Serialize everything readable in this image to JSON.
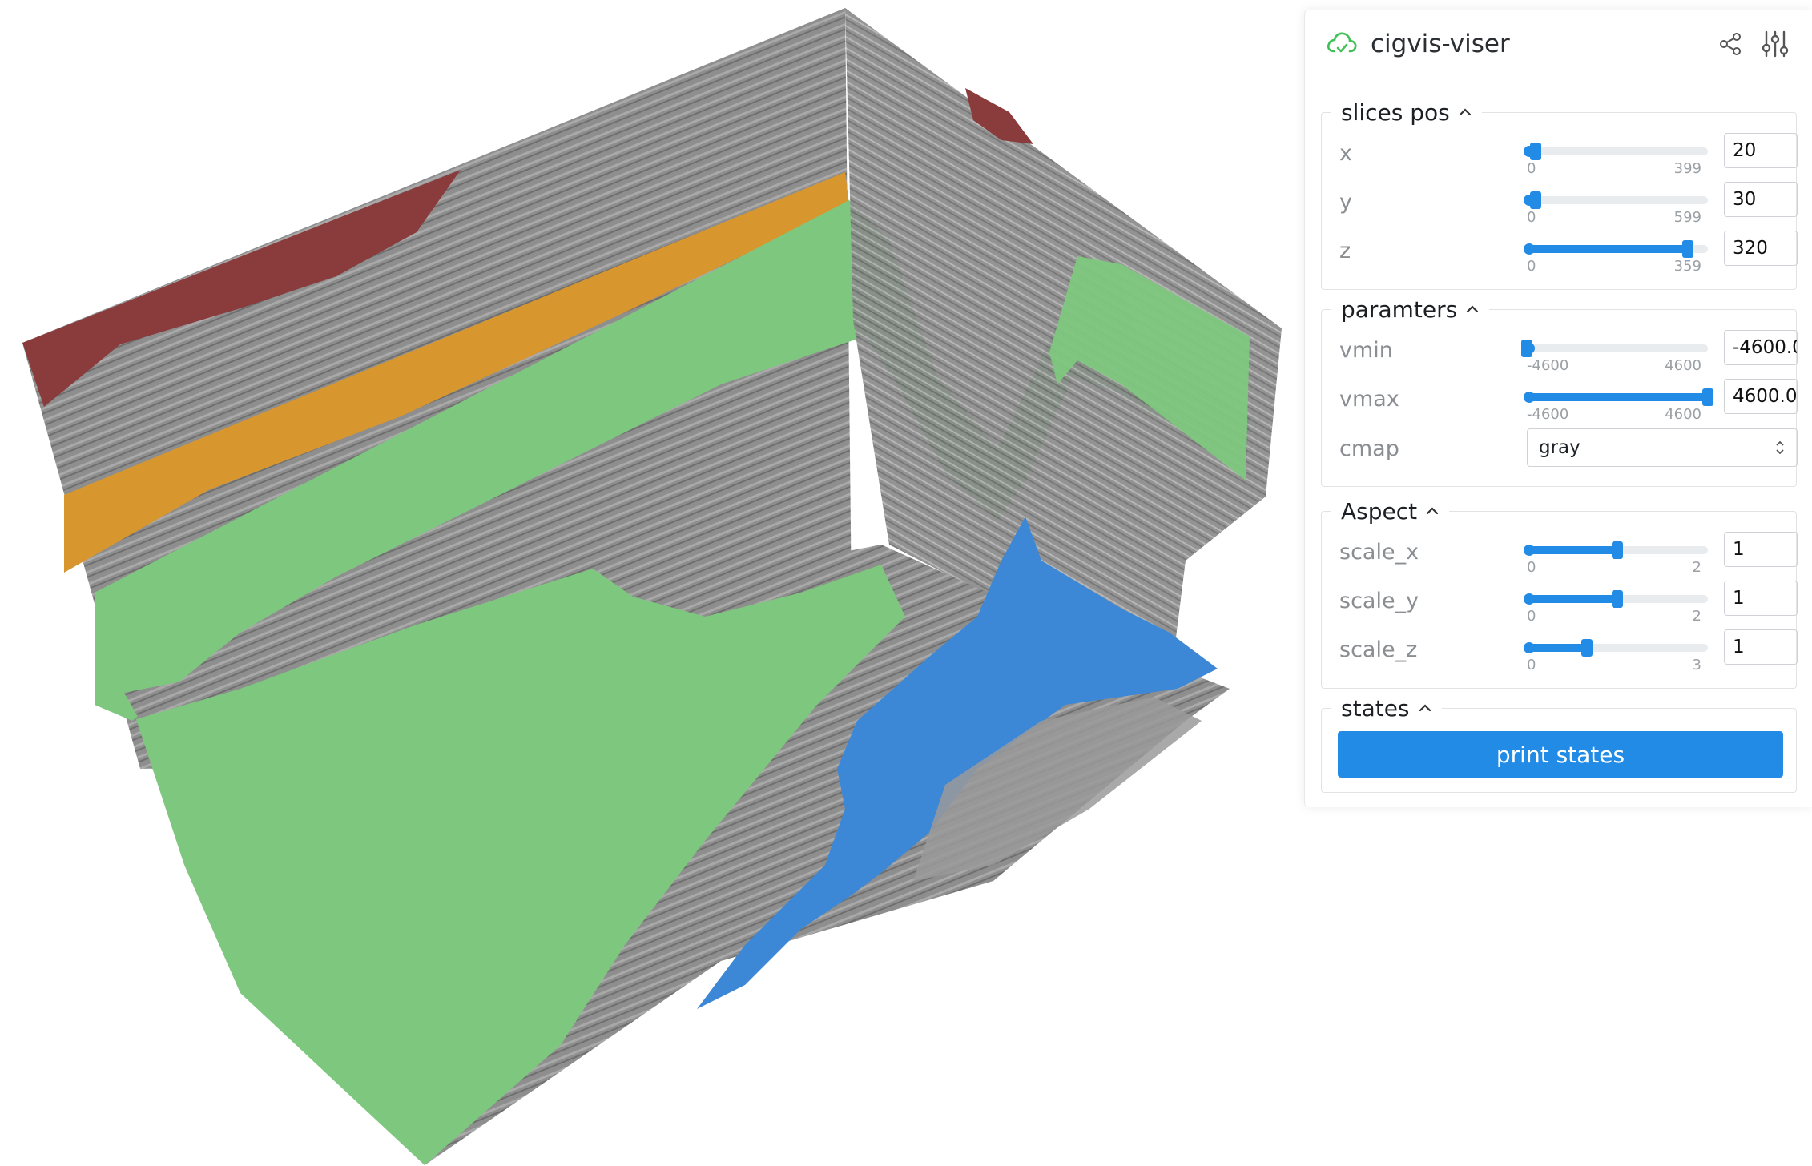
{
  "app": {
    "title": "cigvis-viser",
    "brand_color": "#40c057",
    "accent_color": "#228be6",
    "icons": [
      "cloud-check-icon",
      "share-icon",
      "sliders-icon"
    ]
  },
  "folders": {
    "slices": {
      "title": "slices pos",
      "rows": [
        {
          "label": "x",
          "min": 0,
          "max": 399,
          "value": 20,
          "min_label": "0",
          "max_label": "399",
          "input": "20"
        },
        {
          "label": "y",
          "min": 0,
          "max": 599,
          "value": 30,
          "min_label": "0",
          "max_label": "599",
          "input": "30"
        },
        {
          "label": "z",
          "min": 0,
          "max": 359,
          "value": 320,
          "min_label": "0",
          "max_label": "359",
          "input": "320"
        }
      ]
    },
    "params": {
      "title": "paramters",
      "rows": [
        {
          "label": "vmin",
          "min": -4600,
          "max": 4600,
          "value": -4600,
          "min_label": "-4600",
          "max_label": "4600",
          "input": "-4600.0"
        },
        {
          "label": "vmax",
          "min": -4600,
          "max": 4600,
          "value": 4600,
          "min_label": "-4600",
          "max_label": "4600",
          "input": "4600.0"
        }
      ],
      "cmap": {
        "label": "cmap",
        "value": "gray"
      }
    },
    "aspect": {
      "title": "Aspect",
      "rows": [
        {
          "label": "scale_x",
          "min": 0,
          "max": 2,
          "value": 1,
          "min_label": "0",
          "max_label": "2",
          "input": "1"
        },
        {
          "label": "scale_y",
          "min": 0,
          "max": 2,
          "value": 1,
          "min_label": "0",
          "max_label": "2",
          "input": "1"
        },
        {
          "label": "scale_z",
          "min": 0,
          "max": 3,
          "value": 1,
          "min_label": "0",
          "max_label": "3",
          "input": "1"
        }
      ]
    },
    "states": {
      "title": "states",
      "button_label": "print states"
    }
  },
  "scene": {
    "layer_colors": {
      "seismic": "#8c8c8c",
      "red_layer": "#8a3b3b",
      "orange_layer": "#d8962e",
      "green_layer": "#7ec77e",
      "blue_layer": "#3d88d6"
    }
  }
}
